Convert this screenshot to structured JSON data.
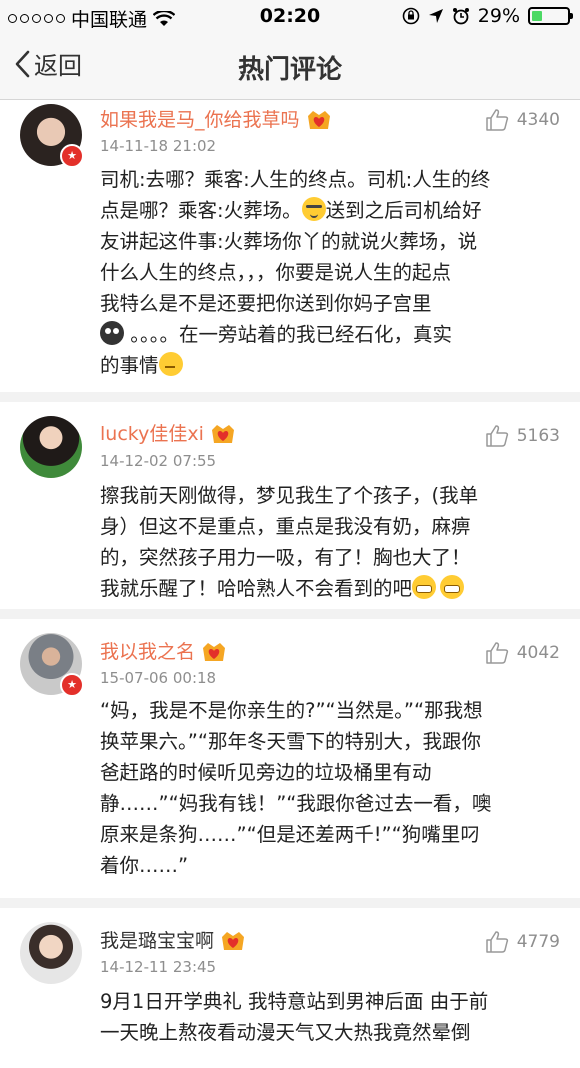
{
  "status": {
    "carrier": "中国联通",
    "time": "02:20",
    "battery": "29%",
    "battery_level": 0.29
  },
  "nav": {
    "back_label": "返回",
    "title": "热门评论"
  },
  "comments": [
    {
      "name": "如果我是马_你给我草吗",
      "time": "14-11-18 21:02",
      "likes": "4340",
      "lines": [
        "司机:去哪？乘客:人生的终点。司机:人生的终",
        "点是哪？乘客:火葬场。",
        "送到之后司机给好",
        "友讲起这件事:火葬场你丫的就说火葬场，说",
        "什么人生的终点，，，你要是说人生的起点",
        "我特么是不是还要把你送到你妈子宫里",
        "。。。。在一旁站着的我已经石化，真实",
        "的事情"
      ]
    },
    {
      "name": "lucky佳佳xi",
      "time": "14-12-02 07:55",
      "likes": "5163",
      "lines": [
        "擦我前天刚做得，梦见我生了个孩子，(我单",
        "身）但这不是重点，重点是我没有奶，麻痹",
        "的，突然孩子用力一吸，有了！胸也大了！",
        "我就乐醒了！哈哈熟人不会看到的吧"
      ]
    },
    {
      "name": "我以我之名",
      "time": "15-07-06 00:18",
      "likes": "4042",
      "lines": [
        "“妈，我是不是你亲生的?”“当然是。”“那我想",
        "换苹果六。”“那年冬天雪下的特别大，我跟你",
        "爸赶路的时候听见旁边的垃圾桶里有动",
        "静……”“妈我有钱！”“我跟你爸过去一看，噢",
        "原来是条狗……”“但是还差两千!”“狗嘴里叼",
        "着你……”"
      ]
    },
    {
      "name": "我是璐宝宝啊",
      "time": "14-12-11 23:45",
      "likes": "4779",
      "lines": [
        "9月1日开学典礼 我特意站到男神后面 由于前",
        "一天晚上熬夜看动漫天气又大热我竟然晕倒"
      ]
    }
  ]
}
